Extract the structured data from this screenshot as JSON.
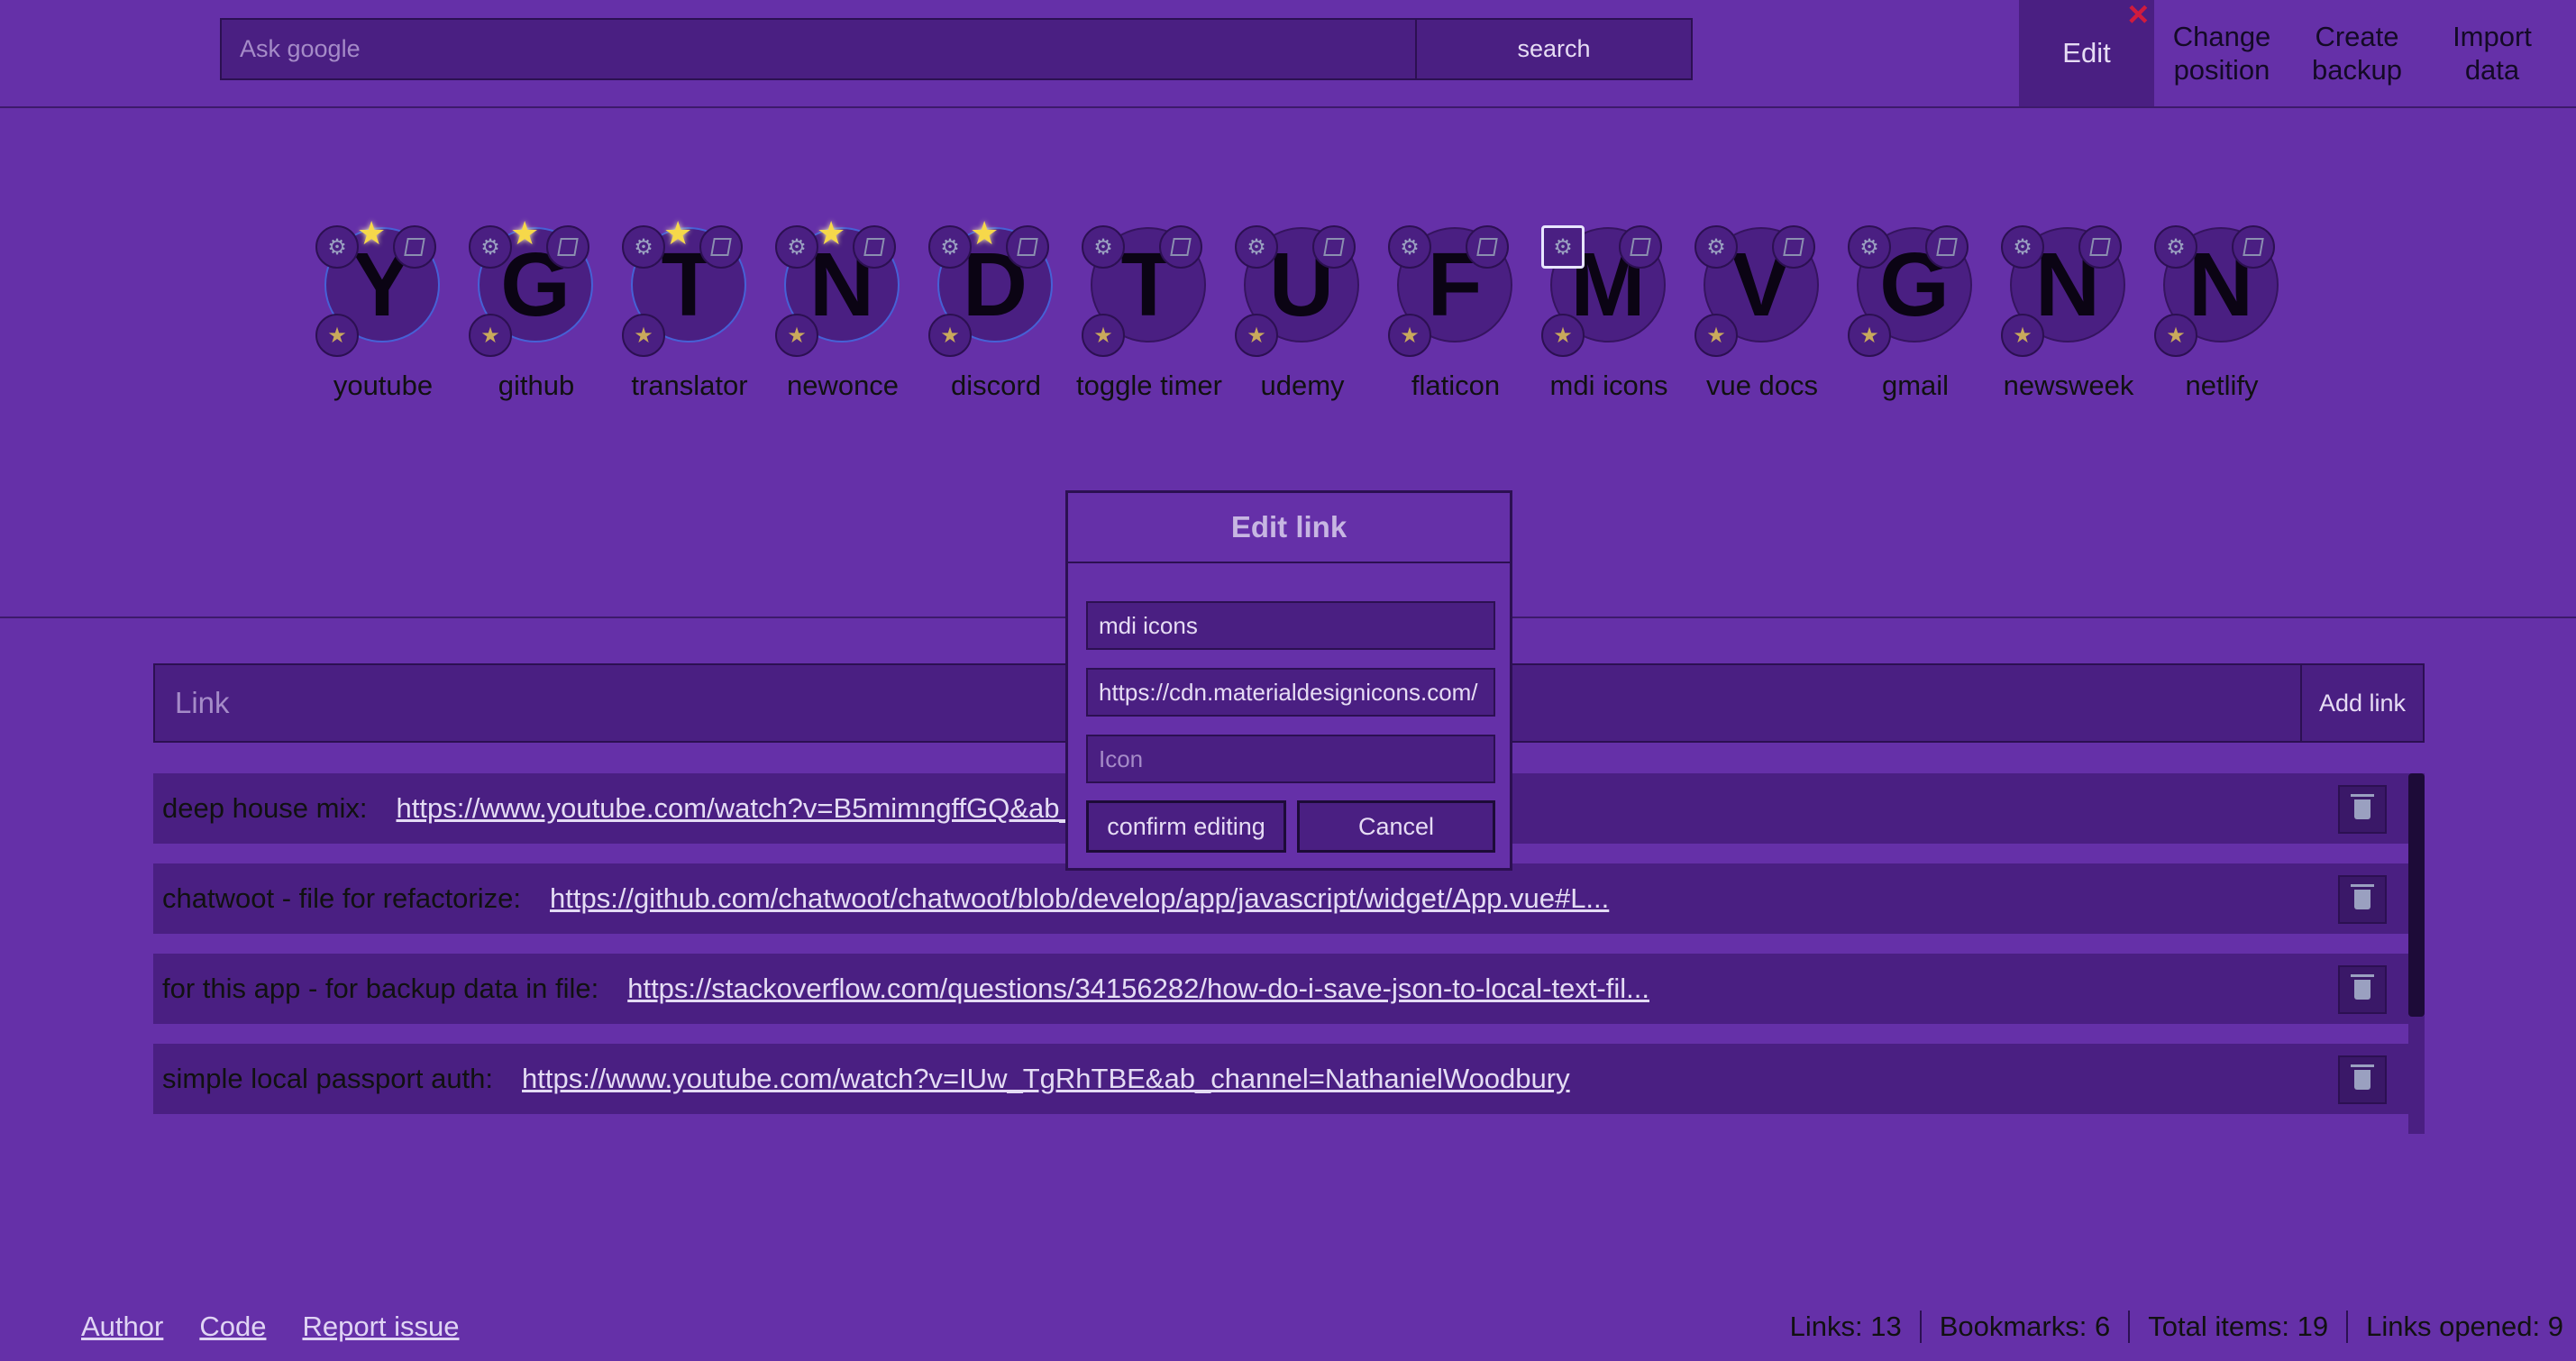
{
  "header": {
    "search_placeholder": "Ask google",
    "search_button": "search",
    "menu": [
      {
        "label": "Edit",
        "active": true
      },
      {
        "label": "Change\nposition"
      },
      {
        "label": "Create\nbackup"
      },
      {
        "label": "Import\ndata"
      }
    ],
    "close_icon": "×"
  },
  "bookmarks": [
    {
      "letter": "Y",
      "name": "youtube",
      "favorite": true
    },
    {
      "letter": "G",
      "name": "github",
      "favorite": true
    },
    {
      "letter": "T",
      "name": "translator",
      "favorite": true
    },
    {
      "letter": "N",
      "name": "newonce",
      "favorite": true
    },
    {
      "letter": "D",
      "name": "discord",
      "favorite": true
    },
    {
      "letter": "T",
      "name": "toggle timer",
      "favorite": false
    },
    {
      "letter": "U",
      "name": "udemy",
      "favorite": false
    },
    {
      "letter": "F",
      "name": "flaticon",
      "favorite": false
    },
    {
      "letter": "M",
      "name": "mdi icons",
      "favorite": false,
      "selected": true
    },
    {
      "letter": "V",
      "name": "vue docs",
      "favorite": false
    },
    {
      "letter": "G",
      "name": "gmail",
      "favorite": false
    },
    {
      "letter": "N",
      "name": "newsweek",
      "favorite": false
    },
    {
      "letter": "N",
      "name": "netlify",
      "favorite": false
    }
  ],
  "link_form": {
    "placeholder": "Link",
    "add_button": "Add link"
  },
  "links": [
    {
      "name": "deep house mix:",
      "url": "https://www.youtube.com/watch?v=B5mimngffGQ&ab_channel=SelectedBase"
    },
    {
      "name": "chatwoot - file for refactorize:",
      "url": "https://github.com/chatwoot/chatwoot/blob/develop/app/javascript/widget/App.vue#L..."
    },
    {
      "name": "for this app - for backup data in file:",
      "url": "https://stackoverflow.com/questions/34156282/how-do-i-save-json-to-local-text-fil..."
    },
    {
      "name": "simple local passport auth:",
      "url": "https://www.youtube.com/watch?v=IUw_TgRhTBE&ab_channel=NathanielWoodbury"
    }
  ],
  "modal": {
    "title": "Edit link",
    "name_value": "mdi icons",
    "url_value": "https://cdn.materialdesignicons.com/",
    "icon_placeholder": "Icon",
    "confirm_button": "confirm editing",
    "cancel_button": "Cancel"
  },
  "footer": {
    "links": [
      "Author",
      "Code",
      "Report issue"
    ],
    "stats": [
      "Links: 13",
      "Bookmarks: 6",
      "Total items: 19",
      "Links opened: 9"
    ]
  },
  "colors": {
    "background": "#6530a8",
    "panel": "#4a1f82",
    "border": "#2c1052",
    "favorite_star": "#f6d84a",
    "close_icon": "#d01b3d"
  }
}
